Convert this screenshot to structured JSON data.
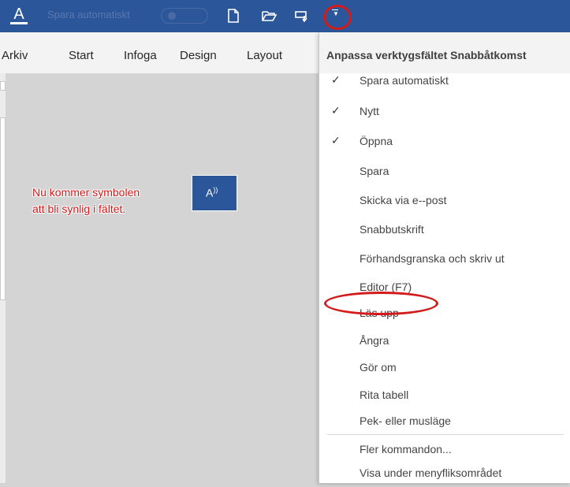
{
  "titlebar": {
    "autosave_label": "Spara automatiskt",
    "app_icon_letter": "A",
    "icons": [
      "new-document-icon",
      "open-folder-icon",
      "touch-mode-icon",
      "customize-qat-icon"
    ]
  },
  "ribbon": {
    "tabs": [
      "Arkiv",
      "Start",
      "Infoga",
      "Design",
      "Layout"
    ]
  },
  "document": {
    "annotation_line1": "Nu kommer symbolen",
    "annotation_line2": "att bli synlig i fältet.",
    "readaloud_glyph": "A",
    "readaloud_waves": "))"
  },
  "menu": {
    "title": "Anpassa verktygsfältet Snabbåtkomst",
    "check_glyph": "✓",
    "items": [
      {
        "label": "Spara automatiskt",
        "checked": true
      },
      {
        "label": "Nytt",
        "checked": true
      },
      {
        "label": "Öppna",
        "checked": true
      },
      {
        "label": "Spara",
        "checked": false
      },
      {
        "label": "Skicka via e--post",
        "checked": false
      },
      {
        "label": "Snabbutskrift",
        "checked": false
      },
      {
        "label": "Förhandsgranska och skriv ut",
        "checked": false
      },
      {
        "label": "Editor (F7)",
        "checked": false
      },
      {
        "label": "Läs upp",
        "checked": false
      },
      {
        "label": "Ångra",
        "checked": false
      },
      {
        "label": "Gör om",
        "checked": false
      },
      {
        "label": "Rita tabell",
        "checked": false
      },
      {
        "label": "Pek- eller musläge",
        "checked": false
      },
      {
        "label": "Fler kommandon...",
        "checked": false
      },
      {
        "label": "Visa under menyfliksområdet",
        "checked": false
      }
    ]
  },
  "colors": {
    "titlebar": "#2b579a",
    "highlight_red": "#d41b1b",
    "annotation_red": "#d01818"
  }
}
